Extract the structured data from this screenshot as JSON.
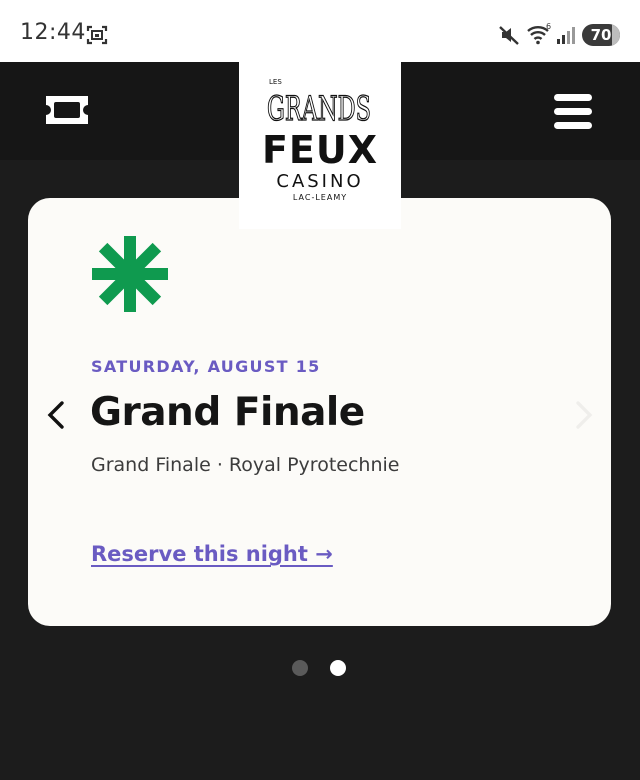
{
  "status_bar": {
    "time": "12:44",
    "battery": "70",
    "icons": [
      "screenshot-icon",
      "mute-icon",
      "wifi-icon",
      "signal-icon",
      "battery-icon"
    ]
  },
  "header": {
    "logo": {
      "les": "LES",
      "grands": "GRANDS",
      "feux": "FEUX",
      "casino": "CASINO",
      "location": "LAC-LEAMY"
    },
    "left_icon": "ticket-icon",
    "right_icon": "hamburger-menu-icon"
  },
  "event": {
    "date": "SATURDAY, AUGUST 15",
    "title": "Grand Finale",
    "subtitle": "Grand Finale · Royal Pyrotechnie",
    "reserve_label": "Reserve this night →",
    "icon": "asterisk-icon"
  },
  "carousel": {
    "prev_icon": "chevron-left-icon",
    "next_icon": "chevron-right-icon",
    "page_count": 2,
    "active_index": 1
  },
  "colors": {
    "accent": "#6a5bc2",
    "asterisk": "#0f9a4f",
    "background": "#1c1c1c",
    "card": "#fcfbf8"
  }
}
